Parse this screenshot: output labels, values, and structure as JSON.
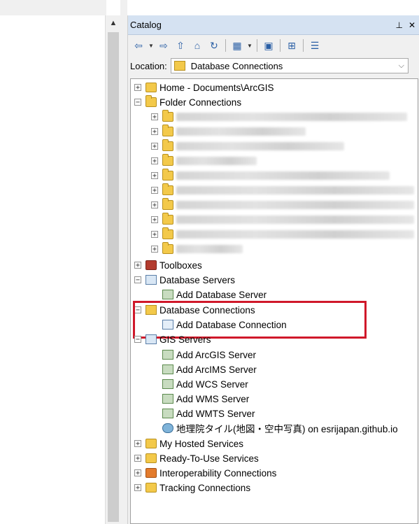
{
  "catalog": {
    "title": "Catalog",
    "pin_glyph": "⊥",
    "close_glyph": "✕",
    "location_label": "Location:",
    "location_value": "Database Connections"
  },
  "toolbar_icons": [
    "back-icon",
    "forward-icon",
    "up-icon",
    "home-icon",
    "refresh-icon",
    "views-icon",
    "connect-folder-icon",
    "toggle-tree-icon",
    "options-icon"
  ],
  "tree": {
    "home": "Home - Documents\\ArcGIS",
    "folder_connections": "Folder Connections",
    "toolboxes": "Toolboxes",
    "database_servers": "Database Servers",
    "add_database_server": "Add Database Server",
    "database_connections": "Database Connections",
    "add_database_connection": "Add Database Connection",
    "gis_servers": "GIS Servers",
    "add_arcgis_server": "Add ArcGIS Server",
    "add_arcims_server": "Add ArcIMS Server",
    "add_wcs_server": "Add WCS Server",
    "add_wms_server": "Add WMS Server",
    "add_wmts_server": "Add WMTS Server",
    "wmts_tile": "地理院タイル(地図・空中写真) on esrijapan.github.io",
    "my_hosted_services": "My Hosted Services",
    "ready_to_use_services": "Ready-To-Use Services",
    "interoperability_connections": "Interoperability Connections",
    "tracking_connections": "Tracking Connections"
  },
  "expander": {
    "plus": "+",
    "minus": "−"
  }
}
